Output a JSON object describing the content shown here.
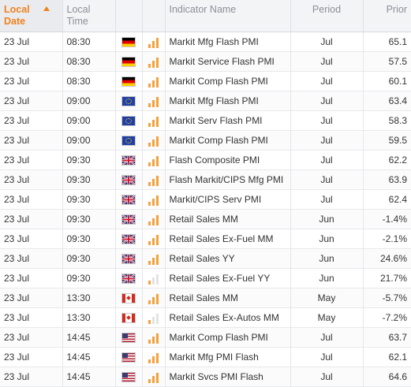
{
  "header": {
    "date_label": "Local Date",
    "time_label": "Local Time",
    "name_label": "Indicator Name",
    "period_label": "Period",
    "prior_label": "Prior"
  },
  "colors": {
    "accent": "#f0821e",
    "importance_bar": "#f4a23c",
    "importance_bar_inactive": "#e3e3e3"
  },
  "rows": [
    {
      "date": "23 Jul",
      "time": "08:30",
      "flag": "germany-flag-icon",
      "importance": 3,
      "name": "Markit Mfg Flash PMI",
      "period": "Jul",
      "prior": "65.1"
    },
    {
      "date": "23 Jul",
      "time": "08:30",
      "flag": "germany-flag-icon",
      "importance": 3,
      "name": "Markit Service Flash PMI",
      "period": "Jul",
      "prior": "57.5"
    },
    {
      "date": "23 Jul",
      "time": "08:30",
      "flag": "germany-flag-icon",
      "importance": 3,
      "name": "Markit Comp Flash PMI",
      "period": "Jul",
      "prior": "60.1"
    },
    {
      "date": "23 Jul",
      "time": "09:00",
      "flag": "eu-flag-icon",
      "importance": 3,
      "name": "Markit Mfg Flash PMI",
      "period": "Jul",
      "prior": "63.4"
    },
    {
      "date": "23 Jul",
      "time": "09:00",
      "flag": "eu-flag-icon",
      "importance": 3,
      "name": "Markit Serv Flash PMI",
      "period": "Jul",
      "prior": "58.3"
    },
    {
      "date": "23 Jul",
      "time": "09:00",
      "flag": "eu-flag-icon",
      "importance": 3,
      "name": "Markit Comp Flash PMI",
      "period": "Jul",
      "prior": "59.5"
    },
    {
      "date": "23 Jul",
      "time": "09:30",
      "flag": "uk-flag-icon",
      "importance": 3,
      "name": "Flash Composite PMI",
      "period": "Jul",
      "prior": "62.2"
    },
    {
      "date": "23 Jul",
      "time": "09:30",
      "flag": "uk-flag-icon",
      "importance": 3,
      "name": "Flash Markit/CIPS Mfg PMI",
      "period": "Jul",
      "prior": "63.9"
    },
    {
      "date": "23 Jul",
      "time": "09:30",
      "flag": "uk-flag-icon",
      "importance": 3,
      "name": "Markit/CIPS Serv PMI",
      "period": "Jul",
      "prior": "62.4"
    },
    {
      "date": "23 Jul",
      "time": "09:30",
      "flag": "uk-flag-icon",
      "importance": 3,
      "name": "Retail Sales MM",
      "period": "Jun",
      "prior": "-1.4%"
    },
    {
      "date": "23 Jul",
      "time": "09:30",
      "flag": "uk-flag-icon",
      "importance": 3,
      "name": "Retail Sales Ex-Fuel MM",
      "period": "Jun",
      "prior": "-2.1%"
    },
    {
      "date": "23 Jul",
      "time": "09:30",
      "flag": "uk-flag-icon",
      "importance": 3,
      "name": "Retail Sales YY",
      "period": "Jun",
      "prior": "24.6%"
    },
    {
      "date": "23 Jul",
      "time": "09:30",
      "flag": "uk-flag-icon",
      "importance": 1,
      "name": "Retail Sales Ex-Fuel YY",
      "period": "Jun",
      "prior": "21.7%"
    },
    {
      "date": "23 Jul",
      "time": "13:30",
      "flag": "canada-flag-icon",
      "importance": 3,
      "name": "Retail Sales MM",
      "period": "May",
      "prior": "-5.7%"
    },
    {
      "date": "23 Jul",
      "time": "13:30",
      "flag": "canada-flag-icon",
      "importance": 1,
      "name": "Retail Sales Ex-Autos MM",
      "period": "May",
      "prior": "-7.2%"
    },
    {
      "date": "23 Jul",
      "time": "14:45",
      "flag": "us-flag-icon",
      "importance": 3,
      "name": "Markit Comp Flash PMI",
      "period": "Jul",
      "prior": "63.7"
    },
    {
      "date": "23 Jul",
      "time": "14:45",
      "flag": "us-flag-icon",
      "importance": 3,
      "name": "Markit Mfg PMI Flash",
      "period": "Jul",
      "prior": "62.1"
    },
    {
      "date": "23 Jul",
      "time": "14:45",
      "flag": "us-flag-icon",
      "importance": 3,
      "name": "Markit Svcs PMI Flash",
      "period": "Jul",
      "prior": "64.6"
    }
  ]
}
